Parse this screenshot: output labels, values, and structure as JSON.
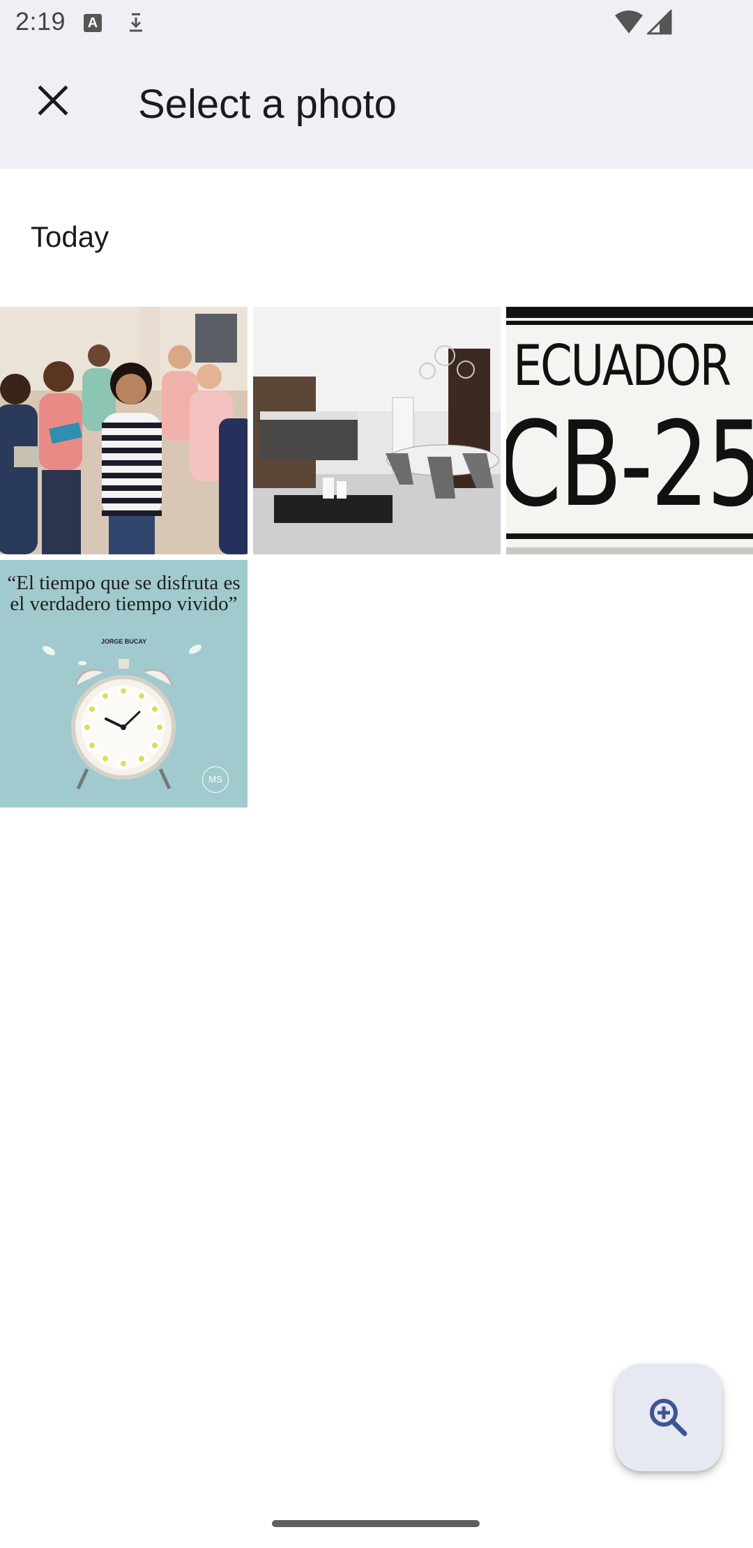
{
  "status_bar": {
    "time": "2:19",
    "notification_icons": [
      "text-input-icon",
      "download-icon"
    ],
    "system_icons": [
      "wifi-icon",
      "cell-signal-icon"
    ]
  },
  "app_bar": {
    "title": "Select a photo",
    "close_icon": "close-icon"
  },
  "section": {
    "label": "Today"
  },
  "photos": [
    {
      "description": "people-group-photo"
    },
    {
      "description": "interior-dining-room-photo"
    },
    {
      "description": "license-plate-photo",
      "text_country": "ECUADOR",
      "text_number": "CB-25"
    },
    {
      "description": "alarm-clock-quote-photo",
      "quote": "“El tiempo que se disfruta es el verdadero tiempo vivido”",
      "author": "JORGE BUCAY",
      "badge": "MS"
    }
  ],
  "fab": {
    "icon": "zoom-in-icon"
  },
  "colors": {
    "app_bar_bg": "#eff0f5",
    "fab_bg": "#e6e8f2",
    "fab_icon": "#3f5591",
    "title_text": "#1b1b1f"
  }
}
